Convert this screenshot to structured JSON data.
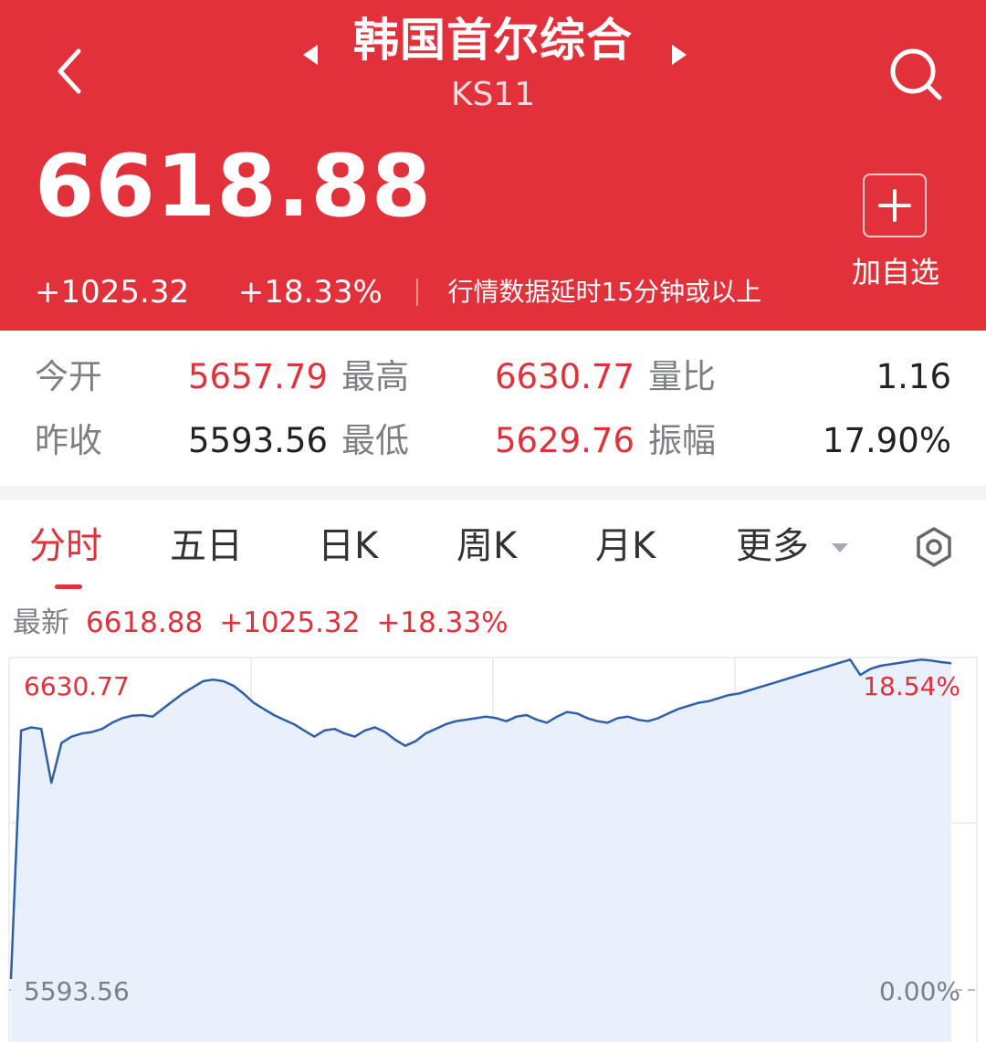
{
  "header": {
    "title": "韩国首尔综合",
    "code": "KS11",
    "back_icon": "chevron-left-icon",
    "prev_icon": "caret-left-icon",
    "next_icon": "caret-right-icon",
    "search_icon": "search-icon",
    "price": "6618.88",
    "change": "+1025.32",
    "change_pct": "+18.33%",
    "delay_note": "行情数据延时15分钟或以上",
    "add_watch_label": "加自选",
    "color": "#e2313a"
  },
  "stats": {
    "open_label": "今开",
    "open_value": "5657.79",
    "high_label": "最高",
    "high_value": "6630.77",
    "vol_ratio_label": "量比",
    "vol_ratio_value": "1.16",
    "prev_close_label": "昨收",
    "prev_close_value": "5593.56",
    "low_label": "最低",
    "low_value": "5629.76",
    "amplitude_label": "振幅",
    "amplitude_value": "17.90%"
  },
  "tabs": [
    {
      "label": "分时",
      "active": true
    },
    {
      "label": "五日"
    },
    {
      "label": "日K"
    },
    {
      "label": "周K"
    },
    {
      "label": "月K"
    },
    {
      "label": "更多"
    }
  ],
  "latest": {
    "label": "最新",
    "price": "6618.88",
    "change": "+1025.32",
    "change_pct": "+18.33%"
  },
  "chart_data": {
    "type": "area",
    "y_top_label": "6630.77",
    "y_top_pct": "18.54%",
    "y_bottom_label": "5593.56",
    "y_bottom_pct": "0.00%",
    "ylim": [
      5593.56,
      6630.77
    ],
    "line_color": "#2f5fa8",
    "fill_color": "#e8f0fb",
    "values": [
      5593.56,
      6400,
      6410,
      6405,
      6230,
      6360,
      6380,
      6390,
      6395,
      6405,
      6425,
      6440,
      6448,
      6450,
      6445,
      6470,
      6495,
      6520,
      6540,
      6560,
      6565,
      6560,
      6545,
      6520,
      6490,
      6470,
      6450,
      6435,
      6420,
      6400,
      6380,
      6400,
      6405,
      6390,
      6380,
      6400,
      6410,
      6395,
      6370,
      6350,
      6365,
      6390,
      6405,
      6420,
      6430,
      6435,
      6440,
      6445,
      6440,
      6430,
      6445,
      6450,
      6435,
      6425,
      6445,
      6460,
      6455,
      6440,
      6430,
      6425,
      6440,
      6445,
      6435,
      6430,
      6440,
      6455,
      6470,
      6480,
      6490,
      6495,
      6505,
      6515,
      6520,
      6530,
      6540,
      6550,
      6560,
      6570,
      6580,
      6590,
      6600,
      6610,
      6620,
      6630,
      6580,
      6600,
      6610,
      6615,
      6620,
      6625,
      6630,
      6627,
      6622,
      6618
    ]
  },
  "gear_icon": "gear-icon"
}
